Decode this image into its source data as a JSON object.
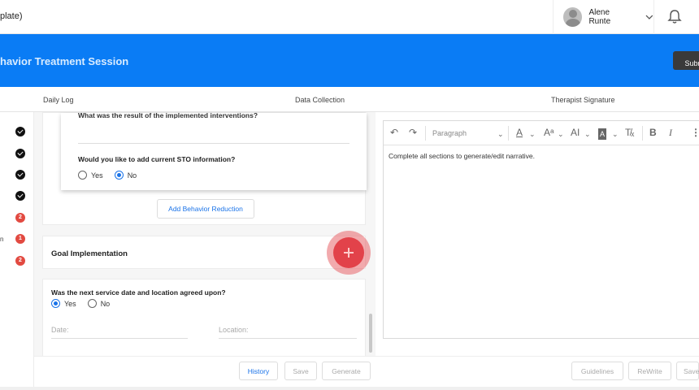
{
  "header": {
    "page_title": "plate)",
    "user_name": "Alene Runte"
  },
  "session": {
    "title": "havior Treatment Session",
    "submit_label": "Subn"
  },
  "tabs": [
    {
      "label": "Daily Log"
    },
    {
      "label": "Data Collection"
    },
    {
      "label": "Therapist Signature"
    }
  ],
  "sidebar": {
    "statuses": [
      {
        "type": "done"
      },
      {
        "type": "done"
      },
      {
        "type": "done"
      },
      {
        "type": "done"
      },
      {
        "type": "count",
        "value": "2"
      },
      {
        "type": "count",
        "value": "1"
      },
      {
        "type": "count",
        "value": "2"
      }
    ],
    "fragment": "n"
  },
  "form": {
    "cut_question": "What was the result of the implemented interventions?",
    "sto_question": "Would you like to add current STO information?",
    "sto_options": {
      "yes": "Yes",
      "no": "No",
      "selected": "No"
    },
    "add_behavior_label": "Add Behavior Reduction",
    "goal_title": "Goal Implementation",
    "next_service_question": "Was the next service date and location agreed upon?",
    "next_service_options": {
      "yes": "Yes",
      "no": "No",
      "selected": "Yes"
    },
    "date_placeholder": "Date:",
    "location_placeholder": "Location:"
  },
  "editor": {
    "block_style": "Paragraph",
    "narrative": "Complete all sections to generate/edit narrative."
  },
  "actions": {
    "history": "History",
    "save": "Save",
    "generate": "Generate",
    "guidelines": "Guidelines",
    "rewrite": "ReWrite",
    "save_right": "Save"
  },
  "colors": {
    "brand_blue": "#0a7cf5",
    "alert_red": "#e24a41",
    "link_blue": "#1a73e8"
  }
}
